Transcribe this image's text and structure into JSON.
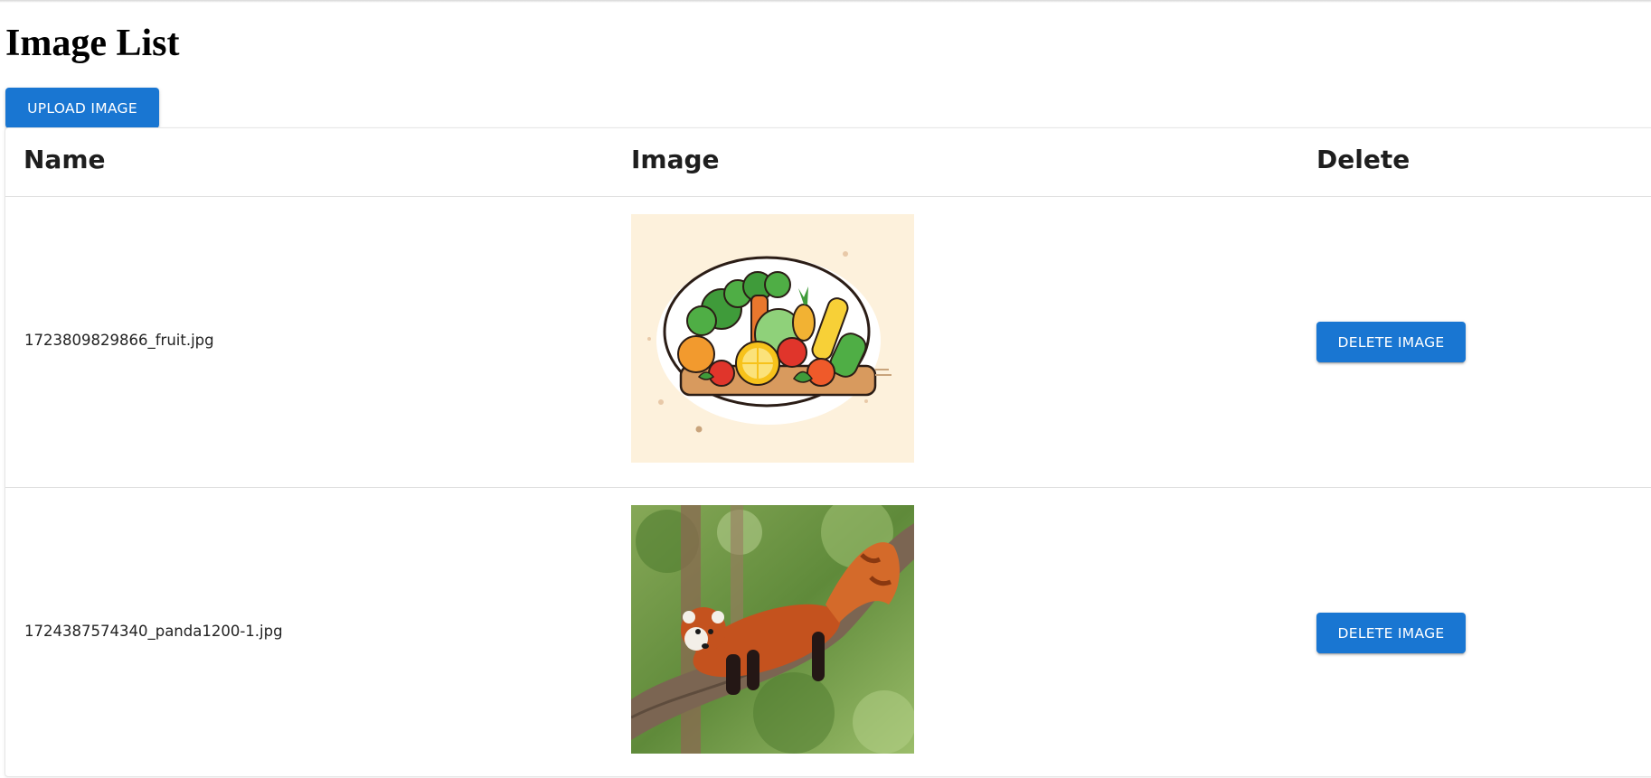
{
  "page": {
    "title": "Image List"
  },
  "toolbar": {
    "upload_label": "UPLOAD IMAGE"
  },
  "table": {
    "headers": [
      "Name",
      "Image",
      "Delete"
    ],
    "rows": [
      {
        "name": "1723809829866_fruit.jpg",
        "image_icon": "fruit-vegetable-illustration",
        "delete_label": "DELETE IMAGE"
      },
      {
        "name": "1724387574340_panda1200-1.jpg",
        "image_icon": "red-panda-photo",
        "delete_label": "DELETE IMAGE"
      }
    ]
  },
  "colors": {
    "primary": "#1976d2",
    "fruit_bg": "#fdf1dc",
    "panda_fur": "#c4521e",
    "foliage": "#6b8f3a"
  }
}
